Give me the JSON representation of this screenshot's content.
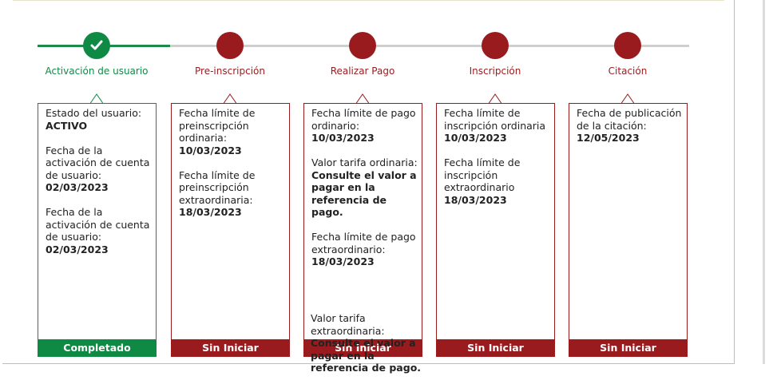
{
  "steps": [
    {
      "label": "Activación de usuario",
      "status": "completed"
    },
    {
      "label": "Pre-inscripción",
      "status": "pending"
    },
    {
      "label": "Realizar Pago",
      "status": "pending"
    },
    {
      "label": "Inscripción",
      "status": "pending"
    },
    {
      "label": "Citación",
      "status": "pending"
    }
  ],
  "cards": {
    "activacion": {
      "estado_label": "Estado del usuario:",
      "estado_value": "ACTIVO",
      "fecha1_label": "Fecha de la activación de cuenta de usuario:",
      "fecha1_value": "02/03/2023",
      "fecha2_label": "Fecha de la activación de cuenta de usuario:",
      "fecha2_value": "02/03/2023",
      "footer": "Completado"
    },
    "preinscripcion": {
      "ord_label": "Fecha límite de preinscripción ordinaria:",
      "ord_value": "10/03/2023",
      "ext_label": "Fecha límite de preinscripción extraordinaria:",
      "ext_value": "18/03/2023",
      "footer": "Sin Iniciar"
    },
    "pago": {
      "ord_label": "Fecha límite de pago ordinario:",
      "ord_value": "10/03/2023",
      "tarifa_ord_label": "Valor tarifa ordinaria:",
      "tarifa_ord_value": "Consulte el valor a pagar en la referencia de pago.",
      "ext_label": "Fecha límite de pago extraordinario:",
      "ext_value": "18/03/2023",
      "tarifa_ext_label": "Valor tarifa extraordinaria:",
      "tarifa_ext_value": "Consulte el valor a pagar en la referencia de pago.",
      "footer": "Sin Iniciar"
    },
    "inscripcion": {
      "ord_label": "Fecha límite de inscripción ordinaria",
      "ord_value": "10/03/2023",
      "ext_label": "Fecha límite de inscripción extraordinario",
      "ext_value": "18/03/2023",
      "footer": "Sin Iniciar"
    },
    "citacion": {
      "pub_label": "Fecha de publicación de la citación:",
      "pub_value": "12/05/2023",
      "footer": "Sin Iniciar"
    }
  },
  "colors": {
    "completed": "#0f8a44",
    "pending": "#991b1e",
    "track": "#cfcfcf"
  },
  "icons": {
    "completed_step": "check-icon"
  }
}
